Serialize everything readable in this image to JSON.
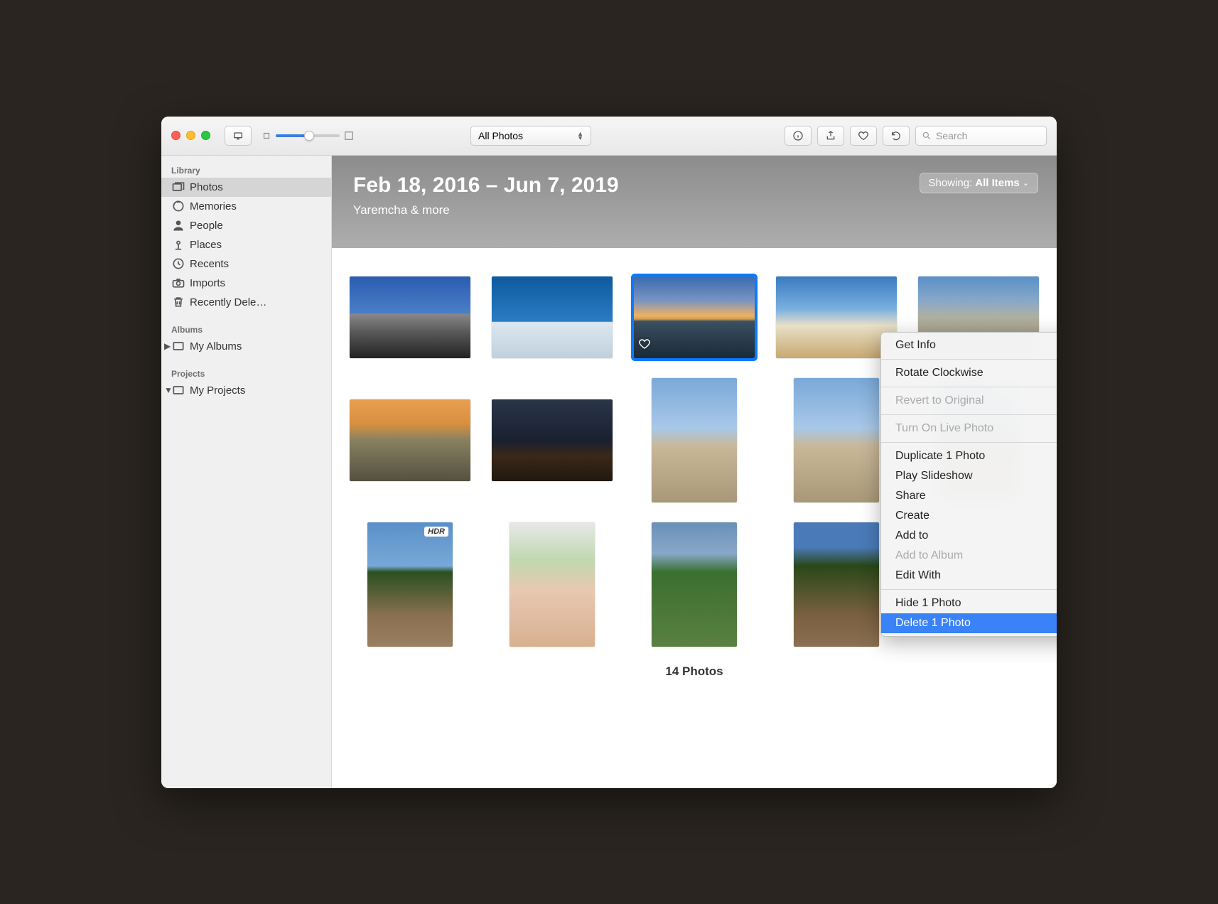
{
  "toolbar": {
    "view_selector": "All Photos",
    "search_placeholder": "Search"
  },
  "sidebar": {
    "sections": {
      "library": {
        "title": "Library"
      },
      "albums": {
        "title": "Albums"
      },
      "projects": {
        "title": "Projects"
      }
    },
    "items": [
      {
        "label": "Photos"
      },
      {
        "label": "Memories"
      },
      {
        "label": "People"
      },
      {
        "label": "Places"
      },
      {
        "label": "Recents"
      },
      {
        "label": "Imports"
      },
      {
        "label": "Recently Dele…"
      },
      {
        "label": "My Albums"
      },
      {
        "label": "My Projects"
      }
    ]
  },
  "header": {
    "title": "Feb 18, 2016 – Jun 7, 2019",
    "subtitle": "Yaremcha & more",
    "showing_label": "Showing:",
    "showing_value": "All Items"
  },
  "context_menu": {
    "get_info": "Get Info",
    "rotate": "Rotate Clockwise",
    "revert": "Revert to Original",
    "live_photo": "Turn On Live Photo",
    "duplicate": "Duplicate 1 Photo",
    "slideshow": "Play Slideshow",
    "share": "Share",
    "create": "Create",
    "add_to": "Add to",
    "add_to_album": "Add to Album",
    "edit_with": "Edit With",
    "hide": "Hide 1 Photo",
    "delete": "Delete 1 Photo"
  },
  "badges": {
    "hdr": "HDR"
  },
  "footer": {
    "count": "14 Photos"
  }
}
